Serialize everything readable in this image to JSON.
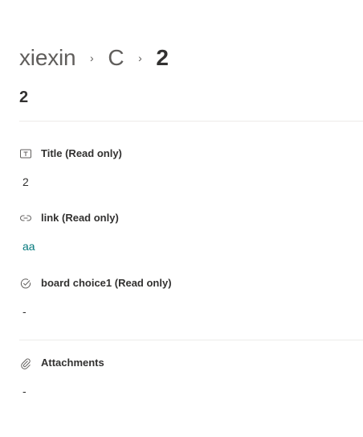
{
  "breadcrumb": {
    "items": [
      "xiexin",
      "C"
    ],
    "separator": "›",
    "current": "2"
  },
  "item": {
    "title": "2"
  },
  "fields": [
    {
      "label": "Title (Read only)",
      "value": "2",
      "icon": "text-field-icon"
    },
    {
      "label": "link (Read only)",
      "value": "aa",
      "icon": "link-icon"
    },
    {
      "label": "board choice1 (Read only)",
      "value": "-",
      "icon": "choice-check-icon"
    }
  ],
  "attachments": {
    "label": "Attachments",
    "value": "-",
    "icon": "paperclip-icon"
  },
  "colors": {
    "link": "#03787c",
    "text": "#323130",
    "muted": "#605e5c",
    "divider": "#edebe9"
  }
}
